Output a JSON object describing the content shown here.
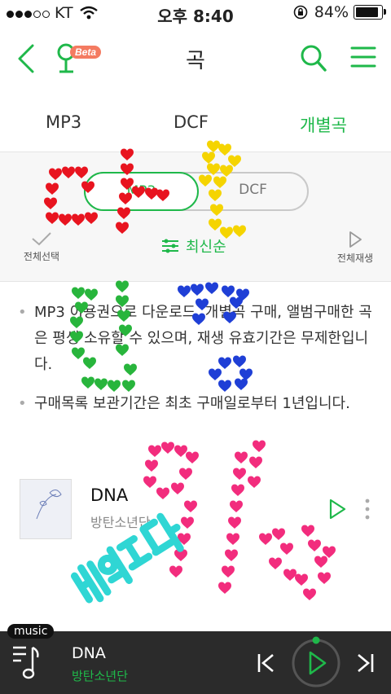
{
  "status": {
    "carrier": "KT",
    "time": "오후 8:40",
    "battery": "84%"
  },
  "header": {
    "title": "곡",
    "beta_label": "Beta"
  },
  "tabs": [
    {
      "label": "MP3",
      "active": false
    },
    {
      "label": "DCF",
      "active": false
    },
    {
      "label": "개별곡",
      "active": true
    }
  ],
  "toggle": {
    "options": [
      "MP3",
      "DCF"
    ],
    "selected": "MP3"
  },
  "actions": {
    "select_all": "전체선택",
    "sort": "최신순",
    "play_all": "전체재생"
  },
  "notices": [
    "MP3 이용권으로 다운로드, 개별곡 구매, 앨범구매한 곡은 평생 소유할 수 있으며, 재생 유효기간은 무제한입니다.",
    "구매목록 보관기간은 최초 구매일로부터 1년입니다."
  ],
  "songs": [
    {
      "title": "DNA",
      "artist": "방탄소년단"
    }
  ],
  "player": {
    "tag": "music",
    "title": "DNA",
    "artist": "방탄소년단"
  },
  "colors": {
    "accent": "#1fb84a",
    "player_bg": "#2b2b2b"
  }
}
